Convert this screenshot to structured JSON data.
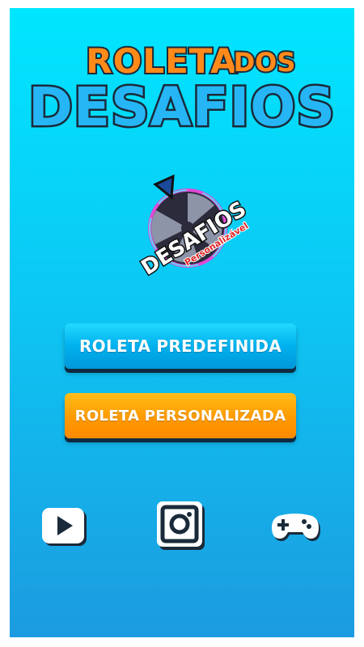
{
  "title": {
    "line1": "ROLETA",
    "line2": "DOS",
    "line3": "DESAFIOS"
  },
  "logo": {
    "word": "DESAFIOS",
    "sub": "Personalizável"
  },
  "buttons": {
    "predefined": "ROLETA PREDEFINIDA",
    "custom": "ROLETA PERSONALIZADA"
  },
  "icons": [
    "youtube-icon",
    "instagram-icon",
    "gamepad-icon"
  ],
  "colors": {
    "background_top": "#00e6ff",
    "background_bottom": "#1c9be0",
    "title_orange": "#ff8a1a",
    "title_blue": "#26b6f5",
    "button_blue": "#00b0ee",
    "button_orange": "#ff9a00",
    "outline_dark": "#1a2a3a"
  }
}
